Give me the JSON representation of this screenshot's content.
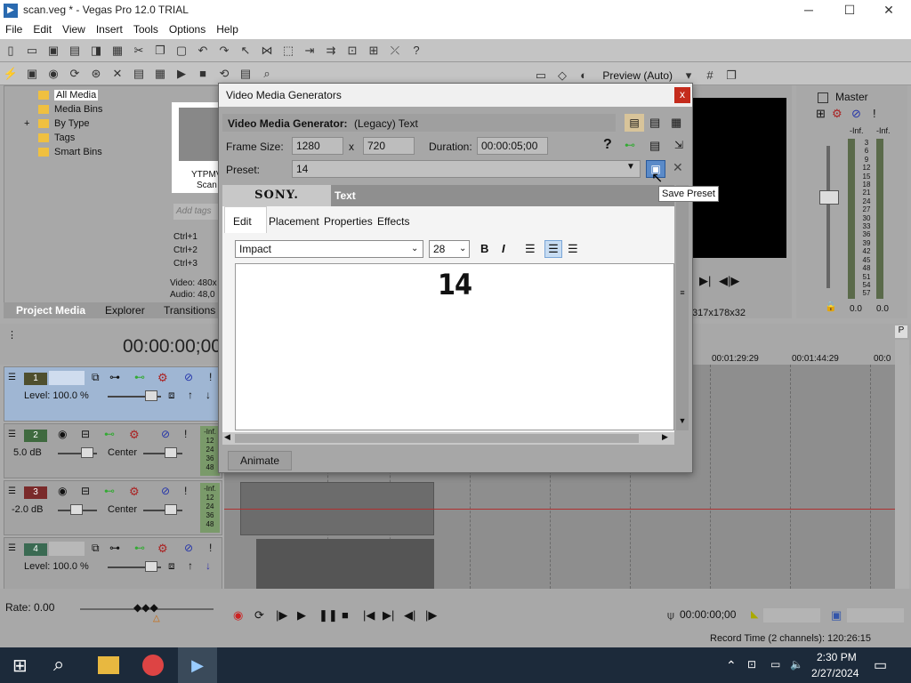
{
  "window": {
    "title": "scan.veg * - Vegas Pro 12.0 TRIAL",
    "minimize": "─",
    "maximize": "☐",
    "close": "✕"
  },
  "menu": [
    "File",
    "Edit",
    "View",
    "Insert",
    "Tools",
    "Options",
    "Help"
  ],
  "preview_label": "Preview (Auto)",
  "project_media": {
    "tree": [
      "All Media",
      "Media Bins",
      "By Type",
      "Tags",
      "Smart Bins"
    ],
    "thumb_label": "YTPMV",
    "thumb_label2": "Scan",
    "add_tags_placeholder": "Add tags",
    "shortcuts": [
      "Ctrl+1",
      "Ctrl+2",
      "Ctrl+3"
    ],
    "video_info": "Video: 480x",
    "audio_info": "Audio: 48,0",
    "tabs": [
      "Project Media",
      "Explorer",
      "Transitions"
    ]
  },
  "master": {
    "label": "Master",
    "left_level": "-Inf.",
    "right_level": "-Inf.",
    "scale": [
      "3",
      "6",
      "9",
      "12",
      "15",
      "18",
      "21",
      "24",
      "27",
      "30",
      "33",
      "36",
      "39",
      "42",
      "45",
      "48",
      "51",
      "54",
      "57"
    ],
    "left_val": "0.0",
    "right_val": "0.0"
  },
  "preview_info": "317x178x32",
  "timeline": {
    "timecode": "00:00:00;00",
    "ruler": [
      "00:01:29:29",
      "00:01:44:29",
      "00:0"
    ],
    "tracks": [
      {
        "num": "1",
        "level": "Level: 100.0 %"
      },
      {
        "num": "2",
        "level": "5.0 dB",
        "pan": "Center",
        "meter": "-Inf."
      },
      {
        "num": "3",
        "level": "-2.0 dB",
        "pan": "Center",
        "meter": "-Inf."
      },
      {
        "num": "4",
        "level": "Level: 100.0 %"
      }
    ],
    "meter_scale": [
      "12",
      "24",
      "36",
      "48"
    ]
  },
  "bottom": {
    "rate": "Rate: 0.00",
    "position": "00:00:00;00",
    "record_time": "Record Time (2 channels): 120:26:15"
  },
  "dialog": {
    "title": "Video Media Generators",
    "close": "x",
    "generator_label": "Video Media Generator:",
    "generator_value": "(Legacy) Text",
    "frame_size_label": "Frame Size:",
    "width": "1280",
    "x_sep": "x",
    "height": "720",
    "duration_label": "Duration:",
    "duration": "00:00:05;00",
    "preset_label": "Preset:",
    "preset_value": "14",
    "sony": "SONY.",
    "plugin_name": "Text",
    "tabs": [
      "Edit",
      "Placement",
      "Properties",
      "Effects"
    ],
    "font": "Impact",
    "font_size": "28",
    "bold": "B",
    "italic": "I",
    "text_content": "14",
    "animate": "Animate",
    "help": "?"
  },
  "tooltip": "Save Preset",
  "taskbar": {
    "time": "2:30 PM",
    "date": "2/27/2024"
  },
  "colors": {
    "track_selected": "#9fb6d3",
    "track1": "#4f4f2e",
    "track2": "#3f6a3f",
    "track3": "#7a2a2a",
    "track4": "#3a6a52",
    "close_red": "#c42b1c",
    "taskbar": "#1c2a3a"
  }
}
